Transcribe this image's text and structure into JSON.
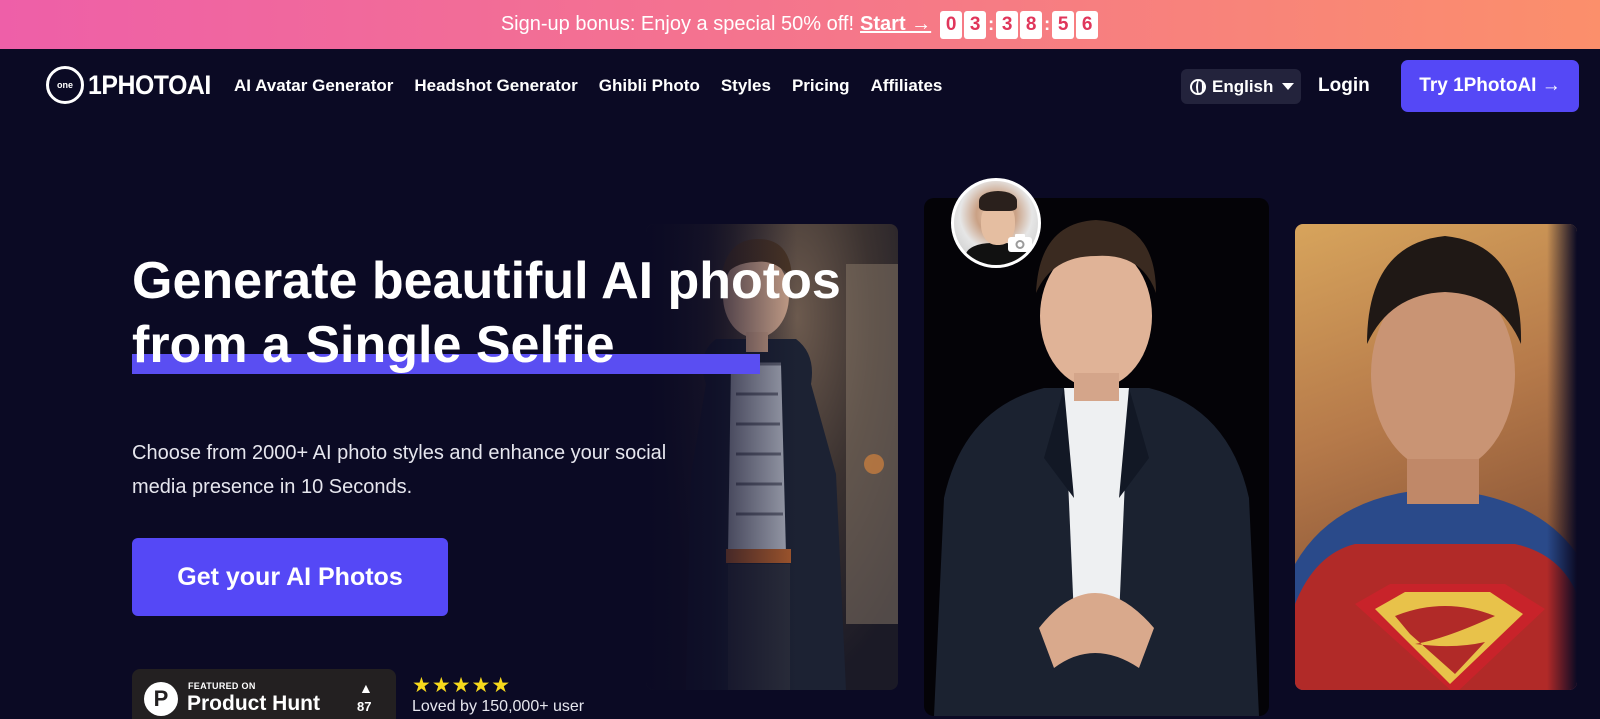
{
  "promo": {
    "text": "Sign-up bonus: Enjoy a special 50% off!",
    "start_label": "Start →",
    "countdown": [
      "0",
      "3",
      "3",
      "8",
      "5",
      "6"
    ]
  },
  "nav": {
    "logo_text": "1PHOTOAI",
    "logo_mark": "one",
    "links": [
      "AI Avatar Generator",
      "Headshot Generator",
      "Ghibli Photo",
      "Styles",
      "Pricing",
      "Affiliates"
    ],
    "language": "English",
    "login": "Login",
    "try_button": "Try 1PhotoAI →"
  },
  "hero": {
    "title_line1": "Generate beautiful AI photos",
    "title_line2": "from a Single Selfie",
    "subtitle": "Choose from 2000+ AI photo styles and enhance your social media presence in 10 Seconds.",
    "cta": "Get your AI Photos"
  },
  "social_proof": {
    "ph_featured": "FEATURED ON",
    "ph_name": "Product Hunt",
    "ph_logo": "P",
    "ph_arrow": "▲",
    "ph_count": "87",
    "stars": "★★★★★",
    "loved": "Loved by 150,000+ user"
  },
  "colors": {
    "background": "#0b0a24",
    "accent": "#5548f6",
    "promo_gradient_start": "#ee5fa8",
    "promo_gradient_end": "#fb8f6b"
  }
}
